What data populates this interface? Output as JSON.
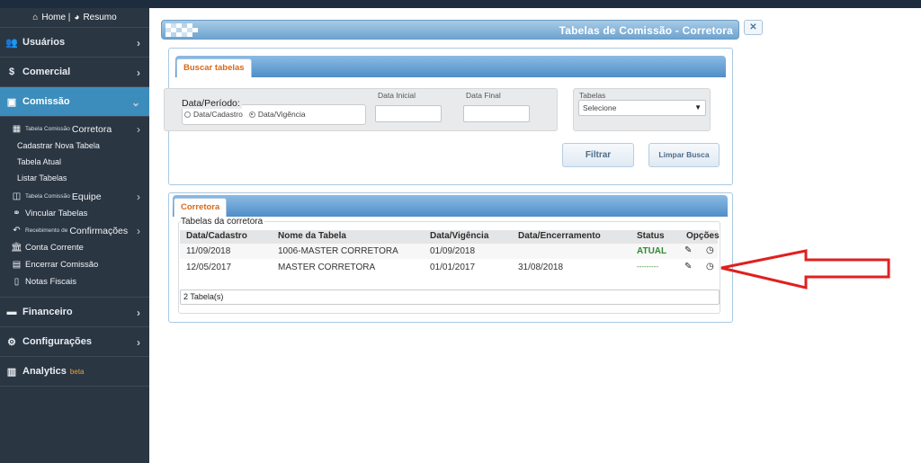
{
  "sidebar": {
    "home_label": "Home |",
    "resumo_label": "Resumo",
    "items": [
      {
        "label": "Usuários",
        "icon": "users-icon"
      },
      {
        "label": "Comercial",
        "icon": "dollar-icon"
      },
      {
        "label": "Comissão",
        "icon": "money-icon"
      }
    ],
    "comissao_sub": {
      "tabela_corretora_small": "Tabela Comissão",
      "tabela_corretora_big": "Corretora",
      "cadastrar": "Cadastrar Nova Tabela",
      "atual": "Tabela Atual",
      "listar": "Listar Tabelas",
      "tabela_equipe_small": "Tabela Comissão",
      "tabela_equipe_big": "Equipe",
      "vincular": "Vincular Tabelas",
      "recebimento_small": "Recebimento de",
      "recebimento_big": "Confirmações",
      "conta_corrente": "Conta Corrente",
      "encerrar": "Encerrar Comissão",
      "notas": "Notas Fiscais"
    },
    "bottom_items": [
      {
        "label": "Financeiro",
        "icon": "briefcase-icon"
      },
      {
        "label": "Configurações",
        "icon": "gears-icon"
      },
      {
        "label": "Analytics",
        "icon": "bar-chart-icon",
        "badge": "beta"
      }
    ]
  },
  "header": {
    "title": "Tabelas de Comissão - Corretora",
    "close_label": "✕"
  },
  "search": {
    "tab_label": "Buscar tabelas",
    "period_legend": "Data/Período:",
    "radio_cadastro": "Data/Cadastro",
    "radio_vigencia": "Data/Vigência",
    "data_inicial_label": "Data Inicial",
    "data_final_label": "Data Final",
    "tabelas_label": "Tabelas",
    "tabelas_selected": "Selecione",
    "filtrar_label": "Filtrar",
    "limpar_label": "Limpar Busca"
  },
  "corretora": {
    "tab_label": "Corretora",
    "group_label": "Tabelas da corretora",
    "columns": [
      "Data/Cadastro",
      "Nome da Tabela",
      "Data/Vigência",
      "Data/Encerramento",
      "Status",
      "Opções"
    ],
    "rows": [
      {
        "cadastro": "11/09/2018",
        "nome": "1006-MASTER CORRETORA",
        "vigencia": "01/09/2018",
        "encerramento": "",
        "status": "ATUAL"
      },
      {
        "cadastro": "12/05/2017",
        "nome": "MASTER CORRETORA",
        "vigencia": "01/01/2017",
        "encerramento": "31/08/2018",
        "status": "---------"
      }
    ],
    "count_text": "2 Tabela(s)"
  },
  "colors": {
    "sidebar_bg": "#2b3643",
    "active_item": "#3c8dbc",
    "tab_text": "#d46a1a",
    "status_green": "#2e8b2e",
    "arrow_red": "#e02020"
  }
}
